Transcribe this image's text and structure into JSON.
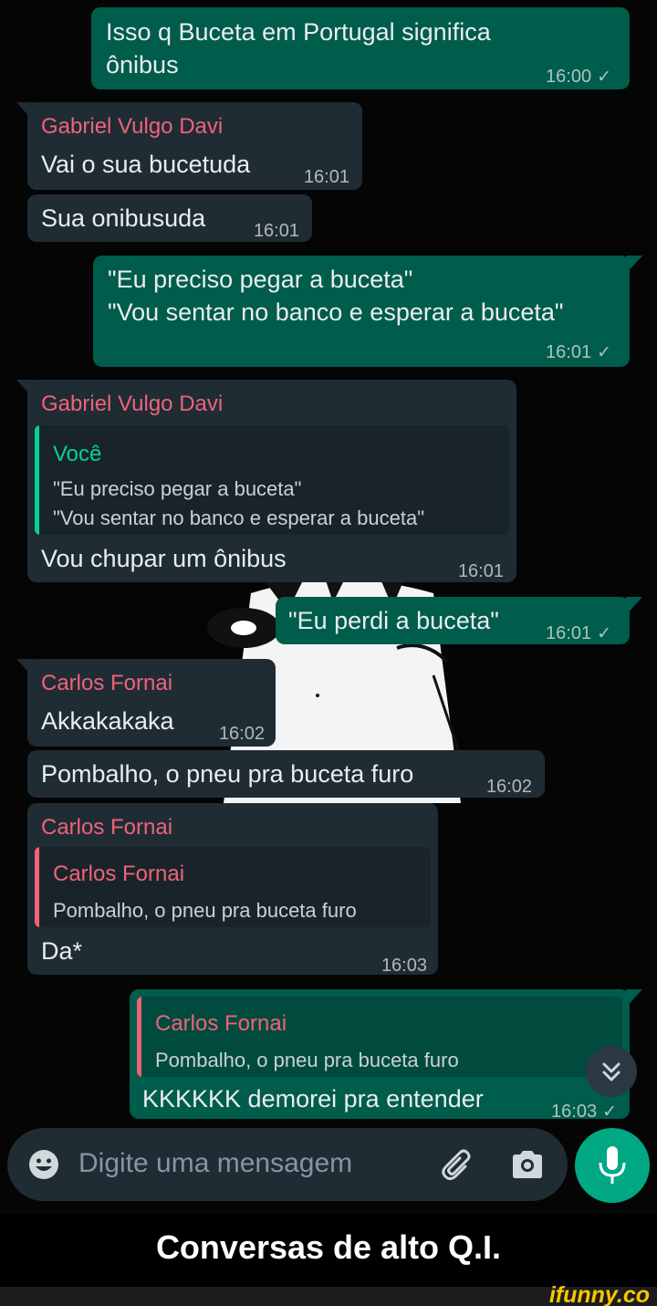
{
  "messages": [
    {
      "text_lines": [
        "Isso q Buceta em Portugal significa",
        "ônibus"
      ],
      "time": "16:00",
      "check": "✓"
    },
    {
      "sender": "Gabriel Vulgo Davi",
      "text": "Vai o sua bucetuda",
      "time": "16:01"
    },
    {
      "text": "Sua onibusuda",
      "time": "16:01"
    },
    {
      "text_lines": [
        "\"Eu preciso pegar a buceta\"",
        "\"Vou sentar no banco e esperar a buceta\""
      ],
      "time": "16:01",
      "check": "✓"
    },
    {
      "sender": "Gabriel Vulgo Davi",
      "quote_name": "Você",
      "quote_lines": [
        "\"Eu preciso pegar a buceta\"",
        "\"Vou sentar no banco e esperar a buceta\""
      ],
      "text": "Vou chupar um ônibus",
      "time": "16:01"
    },
    {
      "text": "\"Eu perdi a buceta\"",
      "time": "16:01",
      "check": "✓"
    },
    {
      "sender": "Carlos Fornai",
      "text": "Akkakakaka",
      "time": "16:02"
    },
    {
      "text": "Pombalho, o pneu pra buceta furo",
      "time": "16:02"
    },
    {
      "sender": "Carlos Fornai",
      "quote_name": "Carlos Fornai",
      "quote_text": "Pombalho, o pneu pra buceta furo",
      "text": "Da*",
      "time": "16:03"
    },
    {
      "quote_name": "Carlos Fornai",
      "quote_text": "Pombalho, o pneu pra buceta furo",
      "text": "KKKKKK demorei pra entender",
      "time": "16:03",
      "check": "✓"
    }
  ],
  "input": {
    "placeholder": "Digite uma mensagem"
  },
  "icons": {
    "emoji": "emoji-icon",
    "attach": "paperclip-icon",
    "camera": "camera-icon",
    "mic": "microphone-icon",
    "scroll": "double-chevron-down-icon"
  },
  "caption": "Conversas de alto Q.I.",
  "watermark": "ifunny.co",
  "colors": {
    "incoming": "#1f2c34",
    "outgoing": "#005c4b",
    "sender_name": "#f0627a",
    "quote_self": "#06cf9c",
    "mic": "#00a884"
  }
}
